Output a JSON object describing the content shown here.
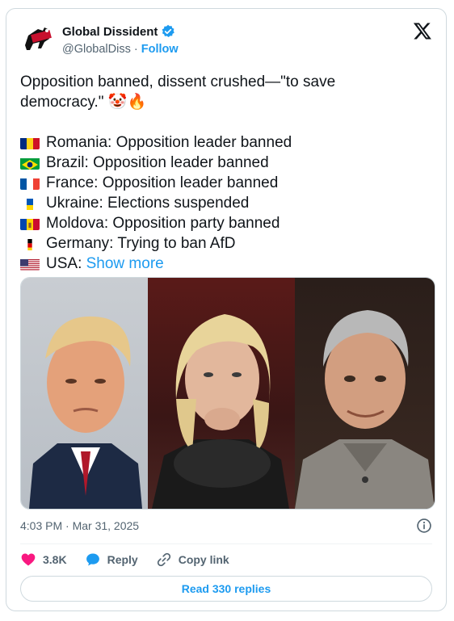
{
  "author": {
    "name": "Global Dissident",
    "handle": "@GlobalDiss",
    "separator": "·",
    "follow_label": "Follow",
    "verified": true
  },
  "tweet": {
    "line1": "Opposition banned, dissent crushed—\"to save",
    "line2": "democracy.\" 🤡🔥",
    "list": [
      {
        "flag": "romania",
        "text": "Romania: Opposition leader banned"
      },
      {
        "flag": "brazil",
        "text": "Brazil: Opposition leader banned"
      },
      {
        "flag": "france",
        "text": "France: Opposition leader banned"
      },
      {
        "flag": "ukraine",
        "text": "Ukraine: Elections suspended"
      },
      {
        "flag": "moldova",
        "text": "Moldova: Opposition party banned"
      },
      {
        "flag": "germany",
        "text": "Germany: Trying to ban AfD"
      },
      {
        "flag": "usa",
        "text": "USA: "
      }
    ],
    "show_more": "Show more"
  },
  "timestamp": "4:03 PM · Mar 31, 2025",
  "actions": {
    "likes": "3.8K",
    "reply_label": "Reply",
    "copy_link_label": "Copy link"
  },
  "read_replies": "Read 330 replies",
  "colors": {
    "accent": "#1d9bf0",
    "like": "#f91880",
    "border": "#cfd9de",
    "muted": "#536471"
  },
  "icons": [
    "avatar-logo",
    "verified-badge-icon",
    "x-logo-icon",
    "info-icon",
    "heart-icon",
    "reply-bubble-icon",
    "link-icon"
  ]
}
